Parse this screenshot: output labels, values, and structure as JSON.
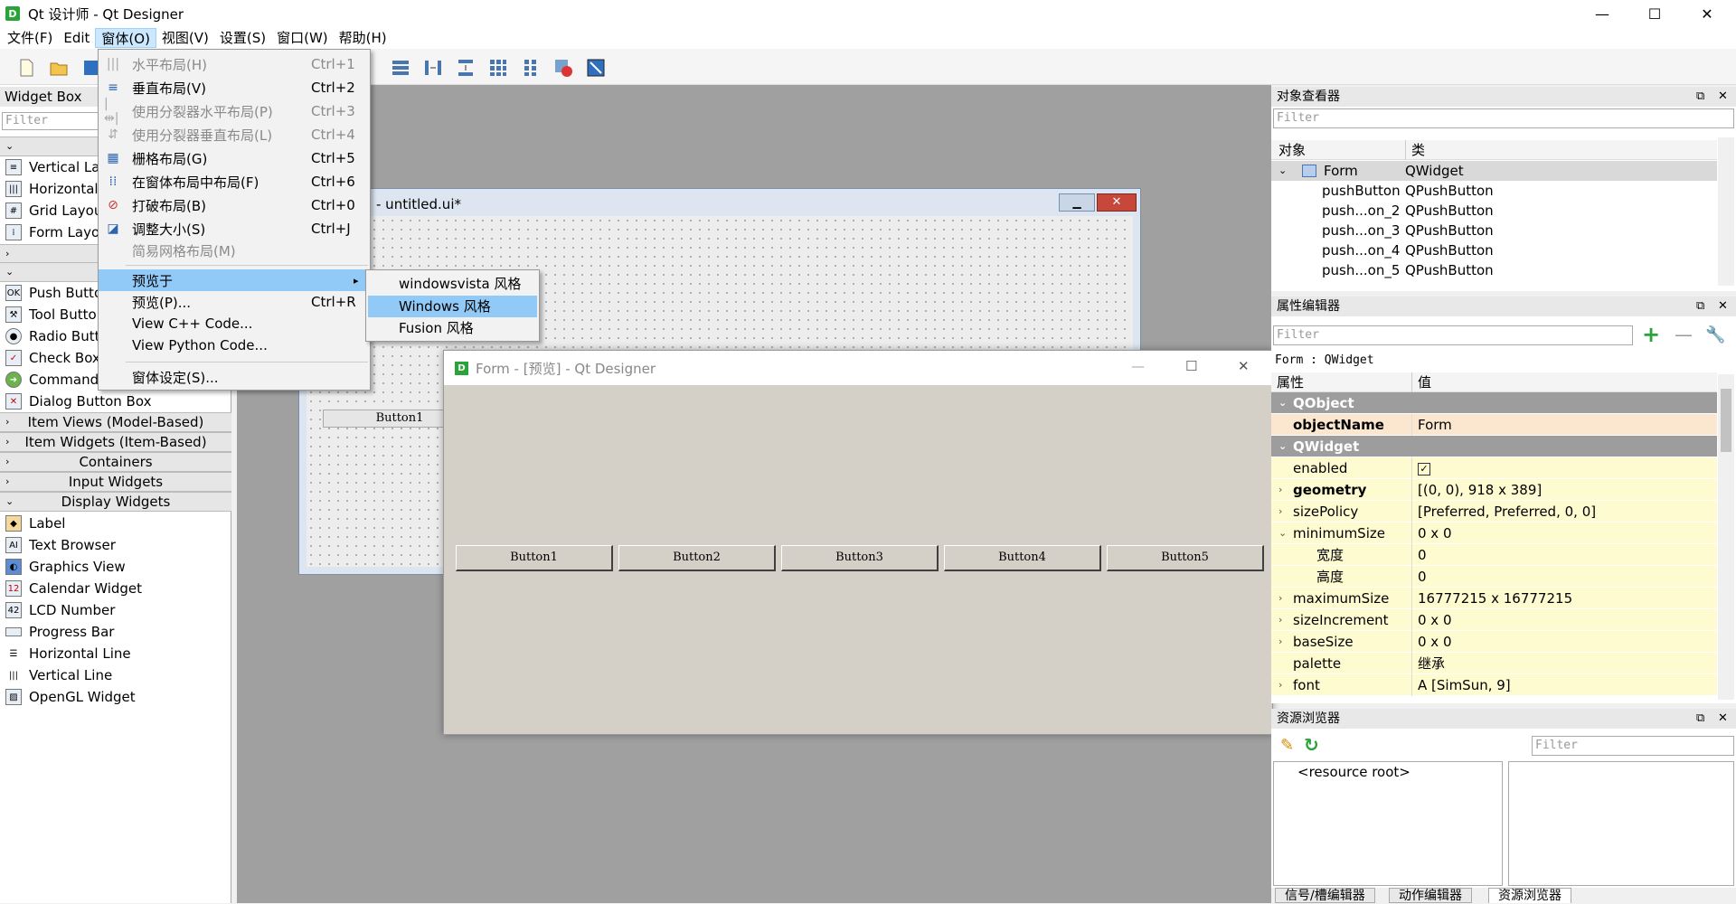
{
  "window": {
    "title": "Qt 设计师 - Qt Designer",
    "app_icon": "D",
    "minimize": "—",
    "maximize": "☐",
    "close": "✕"
  },
  "menubar": [
    "文件(F)",
    "Edit",
    "窗体(O)",
    "视图(V)",
    "设置(S)",
    "窗口(W)",
    "帮助(H)"
  ],
  "widget_box": {
    "title": "Widget Box",
    "filter_placeholder": "Filter",
    "layouts": [
      "Vertical La",
      "Horizontal",
      "Grid Layou",
      "Form Layo"
    ],
    "buttons": [
      "Push Butto",
      "Tool Butto",
      "Radio Butt",
      "Check Box",
      "Command",
      "Dialog Button Box"
    ],
    "categories": [
      "Item Views (Model-Based)",
      "Item Widgets (Item-Based)",
      "Containers",
      "Input Widgets",
      "Display Widgets"
    ],
    "display_widgets": [
      "Label",
      "Text Browser",
      "Graphics View",
      "Calendar Widget",
      "LCD Number",
      "Progress Bar",
      "Horizontal Line",
      "Vertical Line",
      "OpenGL Widget"
    ]
  },
  "form_menu": {
    "items": [
      {
        "label": "水平布局(H)",
        "shortcut": "Ctrl+1",
        "disabled": true
      },
      {
        "label": "垂直布局(V)",
        "shortcut": "Ctrl+2",
        "disabled": false
      },
      {
        "label": "使用分裂器水平布局(P)",
        "shortcut": "Ctrl+3",
        "disabled": true
      },
      {
        "label": "使用分裂器垂直布局(L)",
        "shortcut": "Ctrl+4",
        "disabled": true
      },
      {
        "label": "栅格布局(G)",
        "shortcut": "Ctrl+5",
        "disabled": false
      },
      {
        "label": "在窗体布局中布局(F)",
        "shortcut": "Ctrl+6",
        "disabled": false
      },
      {
        "label": "打破布局(B)",
        "shortcut": "Ctrl+0",
        "disabled": false
      },
      {
        "label": "调整大小(S)",
        "shortcut": "Ctrl+J",
        "disabled": false
      },
      {
        "label": "简易网格布局(M)",
        "shortcut": "",
        "disabled": true
      },
      {
        "label": "预览于",
        "shortcut": "",
        "disabled": false
      },
      {
        "label": "预览(P)...",
        "shortcut": "Ctrl+R",
        "disabled": false
      },
      {
        "label": "View C++ Code...",
        "shortcut": "",
        "disabled": false
      },
      {
        "label": "View Python Code...",
        "shortcut": "",
        "disabled": false
      },
      {
        "label": "窗体设定(S)...",
        "shortcut": "",
        "disabled": false
      }
    ],
    "submenu_arrow": "▸"
  },
  "preview_submenu": [
    "windowsvista 风格",
    "Windows 风格",
    "Fusion 风格"
  ],
  "mdi_form": {
    "title": "- untitled.ui*",
    "button": "Button1"
  },
  "preview_window": {
    "title": "Form - [预览] - Qt Designer",
    "buttons": [
      "Button1",
      "Button2",
      "Button3",
      "Button4",
      "Button5"
    ]
  },
  "object_inspector": {
    "title": "对象查看器",
    "filter_placeholder": "Filter",
    "col_object": "对象",
    "col_class": "类",
    "rows": [
      {
        "name": "Form",
        "cls": "QWidget"
      },
      {
        "name": "pushButton",
        "cls": "QPushButton"
      },
      {
        "name": "push...on_2",
        "cls": "QPushButton"
      },
      {
        "name": "push...on_3",
        "cls": "QPushButton"
      },
      {
        "name": "push...on_4",
        "cls": "QPushButton"
      },
      {
        "name": "push...on_5",
        "cls": "QPushButton"
      }
    ]
  },
  "property_editor": {
    "title": "属性编辑器",
    "filter_placeholder": "Filter",
    "context": "Form : QWidget",
    "col_property": "属性",
    "col_value": "值",
    "rows": [
      {
        "name": "QObject",
        "value": "",
        "kind": "group"
      },
      {
        "name": "objectName",
        "value": "Form",
        "kind": "orange",
        "bold": true
      },
      {
        "name": "QWidget",
        "value": "",
        "kind": "group"
      },
      {
        "name": "enabled",
        "value": "✓",
        "kind": "yellow"
      },
      {
        "name": "geometry",
        "value": "[(0, 0), 918 x 389]",
        "kind": "yellow",
        "bold": true,
        "exp": "›"
      },
      {
        "name": "sizePolicy",
        "value": "[Preferred, Preferred, 0, 0]",
        "kind": "yellow",
        "exp": "›"
      },
      {
        "name": "minimumSize",
        "value": "0 x 0",
        "kind": "yellow",
        "exp": "⌄"
      },
      {
        "name": "宽度",
        "value": "0",
        "kind": "yellow",
        "indent": true
      },
      {
        "name": "高度",
        "value": "0",
        "kind": "yellow",
        "indent": true
      },
      {
        "name": "maximumSize",
        "value": "16777215 x 16777215",
        "kind": "yellow",
        "exp": "›"
      },
      {
        "name": "sizeIncrement",
        "value": "0 x 0",
        "kind": "yellow",
        "exp": "›"
      },
      {
        "name": "baseSize",
        "value": "0 x 0",
        "kind": "yellow",
        "exp": "›"
      },
      {
        "name": "palette",
        "value": "继承",
        "kind": "yellow"
      },
      {
        "name": "font",
        "value": "A  [SimSun, 9]",
        "kind": "yellow",
        "exp": "›"
      }
    ]
  },
  "resource_browser": {
    "title": "资源浏览器",
    "filter_placeholder": "Filter",
    "root": "<resource root>"
  },
  "bottom_tabs": [
    "信号/槽编辑器",
    "动作编辑器",
    "资源浏览器"
  ],
  "colors": {
    "menu_highlight": "#91c9f7",
    "group_header": "#9d9d9d",
    "property_yellow": "#fffbd0",
    "property_orange": "#fbe6cf"
  }
}
